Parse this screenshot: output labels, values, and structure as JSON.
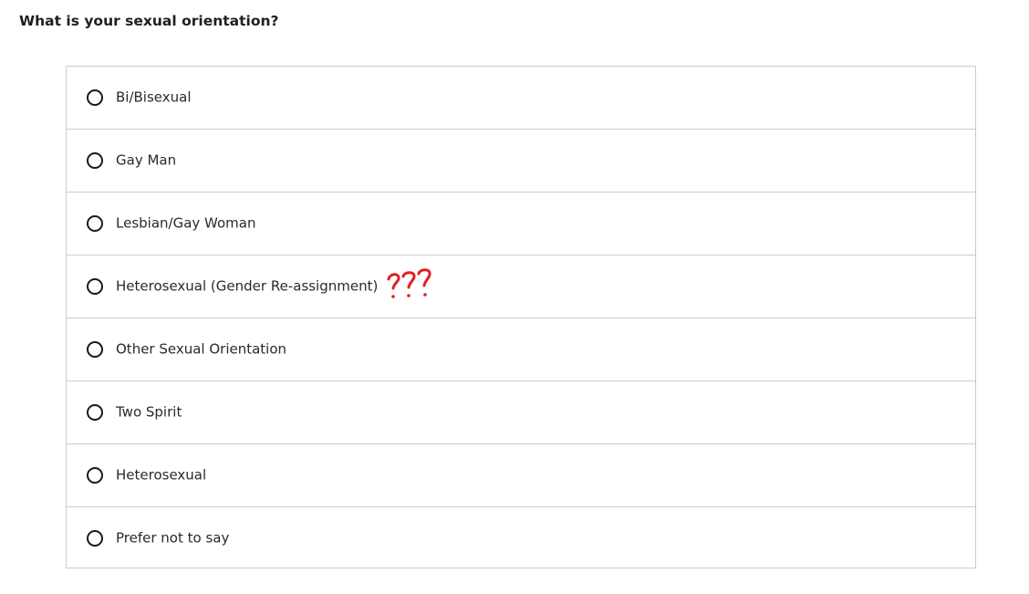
{
  "question": {
    "text": "What is your sexual orientation?"
  },
  "options": [
    {
      "label": "Bi/Bisexual",
      "selected": false
    },
    {
      "label": "Gay Man",
      "selected": false
    },
    {
      "label": "Lesbian/Gay Woman",
      "selected": false
    },
    {
      "label": "Heterosexual (Gender Re-assignment)",
      "selected": false
    },
    {
      "label": "Other Sexual Orientation",
      "selected": false
    },
    {
      "label": "Two Spirit",
      "selected": false
    },
    {
      "label": "Heterosexual",
      "selected": false
    },
    {
      "label": "Prefer not to say",
      "selected": false
    }
  ],
  "annotation": {
    "text": "???",
    "color": "#e02020"
  },
  "colors": {
    "border": "#cccccc",
    "radio_border": "#1a1a1a",
    "text": "#2a2a2a"
  }
}
